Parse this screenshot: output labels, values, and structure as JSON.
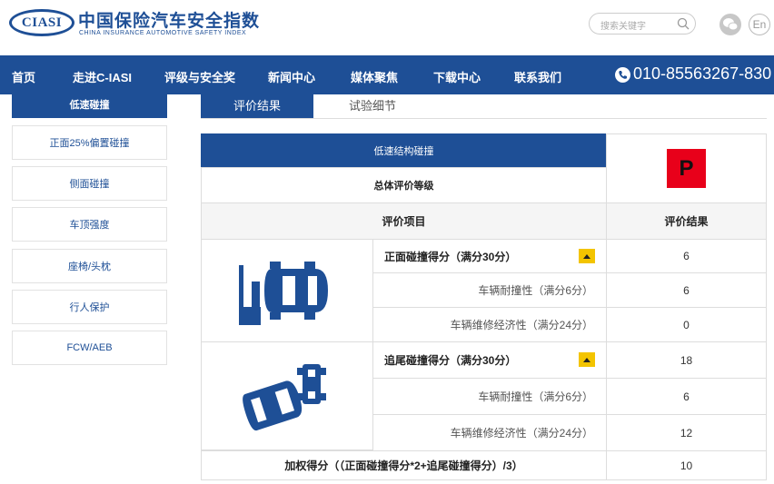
{
  "header": {
    "logo_text": "CIASI",
    "title_cn": "中国保险汽车安全指数",
    "title_en": "CHINA INSURANCE AUTOMOTIVE SAFETY INDEX",
    "search_placeholder": "搜索关键字",
    "lang_button": "En"
  },
  "nav": {
    "items": [
      "首页",
      "走进C-IASI",
      "评级与安全奖",
      "新闻中心",
      "媒体聚焦",
      "下载中心",
      "联系我们"
    ],
    "phone": "010-85563267-830"
  },
  "sidebar": {
    "active": "低速碰撞",
    "items": [
      "正面25%偏置碰撞",
      "侧面碰撞",
      "车顶强度",
      "座椅/头枕",
      "行人保护",
      "FCW/AEB"
    ]
  },
  "tabs": [
    "评价结果",
    "试验细节"
  ],
  "table": {
    "section_title": "低速结构碰撞",
    "overall_label": "总体评价等级",
    "overall_grade": "P",
    "grade_color": "#e8001a",
    "accent_color": "#1e4f96",
    "col_item": "评价项目",
    "col_result": "评价结果",
    "front": {
      "label": "正面碰撞得分（满分30分）",
      "score": "6",
      "rows": [
        {
          "label": "车辆耐撞性（满分6分）",
          "score": "6"
        },
        {
          "label": "车辆维修经济性（满分24分）",
          "score": "0"
        }
      ]
    },
    "rear": {
      "label": "追尾碰撞得分（满分30分）",
      "score": "18",
      "rows": [
        {
          "label": "车辆耐撞性（满分6分）",
          "score": "6"
        },
        {
          "label": "车辆维修经济性（满分24分）",
          "score": "12"
        }
      ]
    },
    "weighted_label": "加权得分（（正面碰撞得分*2+追尾碰撞得分）/3）",
    "weighted_score": "10"
  }
}
